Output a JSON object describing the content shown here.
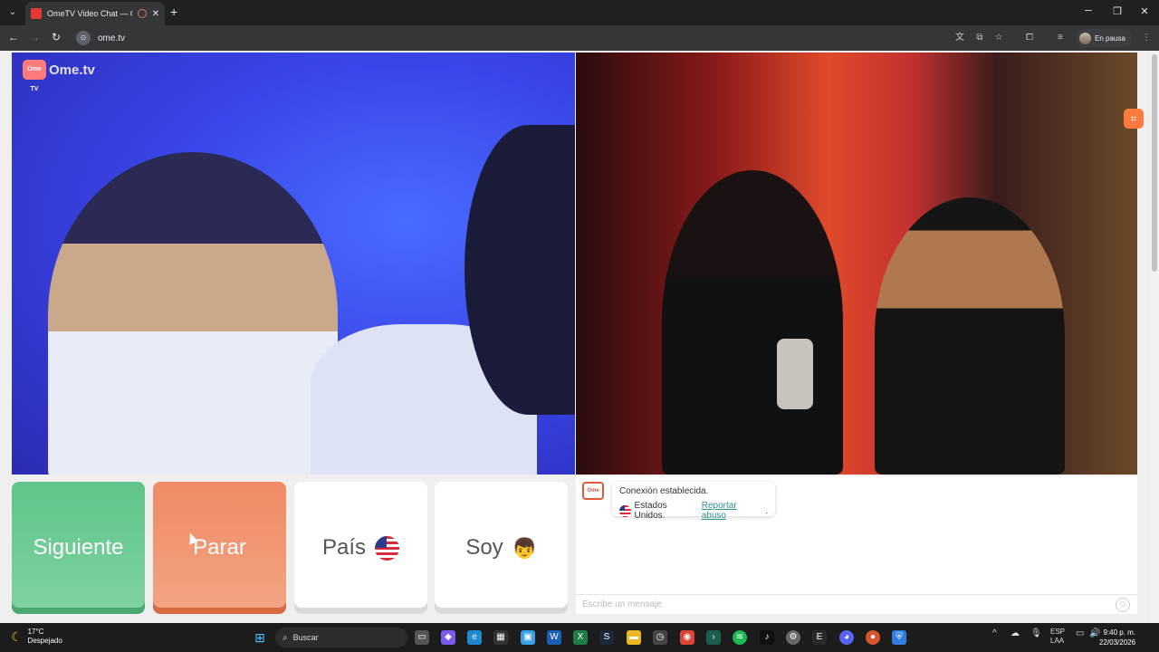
{
  "browser": {
    "tab_title": "OmeTV Video Chat — Ome",
    "url": "ome.tv",
    "profile_label": "En pausa"
  },
  "page": {
    "logo_text": "Ome.tv",
    "logo_badge": "Ome TV",
    "controls": {
      "next_label": "Siguiente",
      "stop_label": "Parar",
      "country_label": "País",
      "me_label": "Soy"
    },
    "chat": {
      "status_line": "Conexión establecida.",
      "country_text": "Estados Unidos.",
      "report_link": "Reportar abuso",
      "report_suffix": ".",
      "input_placeholder": "Escribe un mensaje"
    }
  },
  "taskbar": {
    "temperature": "17°C",
    "weather": "Despejado",
    "search_label": "Buscar",
    "lang_top": "ESP",
    "lang_bottom": "LAA",
    "time": "9:40 p. m.",
    "date": "22/03/2026"
  }
}
